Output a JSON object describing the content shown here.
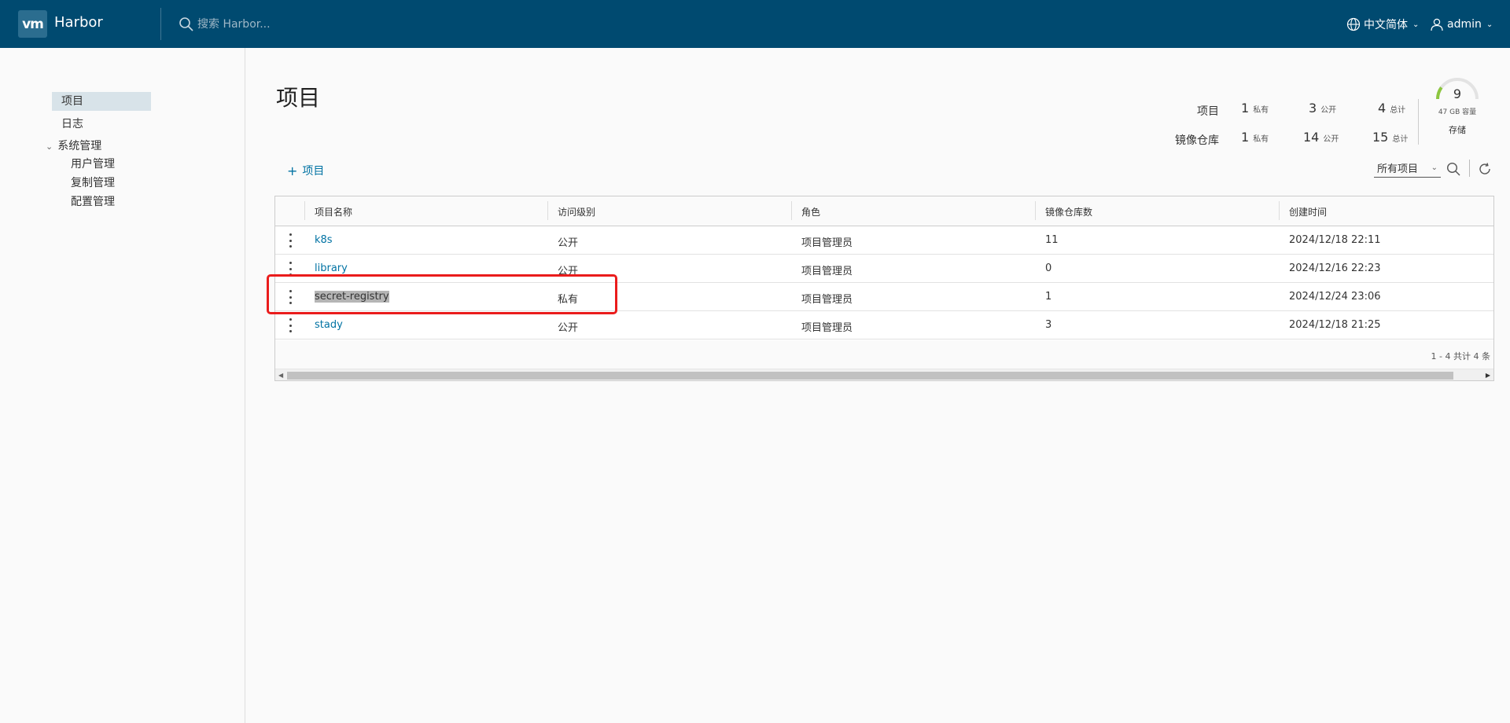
{
  "header": {
    "logo_text": "vm",
    "brand": "Harbor",
    "search_placeholder": "搜索 Harbor...",
    "language": "中文简体",
    "user": "admin"
  },
  "sidebar": {
    "items": [
      {
        "label": "项目"
      },
      {
        "label": "日志"
      },
      {
        "label": "系统管理"
      }
    ],
    "sub_items": [
      {
        "label": "用户管理"
      },
      {
        "label": "复制管理"
      },
      {
        "label": "配置管理"
      }
    ]
  },
  "main": {
    "title": "项目",
    "stats": {
      "projects_label": "项目",
      "repos_label": "镜像仓库",
      "private_label": "私有",
      "public_label": "公开",
      "total_label": "总计",
      "projects": {
        "private": "1",
        "public": "3",
        "total": "4"
      },
      "repos": {
        "private": "1",
        "public": "14",
        "total": "15"
      }
    },
    "storage": {
      "value": "9",
      "capacity": "47 GB 容量",
      "label": "存储",
      "used_fraction": 0.2
    },
    "add_project_label": "项目",
    "filter_label": "所有项目",
    "table": {
      "columns": [
        "项目名称",
        "访问级别",
        "角色",
        "镜像仓库数",
        "创建时间"
      ],
      "rows": [
        {
          "name": "k8s",
          "access": "公开",
          "role": "项目管理员",
          "repos": "11",
          "created": "2024/12/18 22:11"
        },
        {
          "name": "library",
          "access": "公开",
          "role": "项目管理员",
          "repos": "0",
          "created": "2024/12/16 22:23"
        },
        {
          "name": "secret-registry",
          "access": "私有",
          "role": "项目管理员",
          "repos": "1",
          "created": "2024/12/24 23:06"
        },
        {
          "name": "stady",
          "access": "公开",
          "role": "项目管理员",
          "repos": "3",
          "created": "2024/12/18 21:25"
        }
      ],
      "footer": "1 - 4 共计 4 条"
    }
  },
  "colors": {
    "header_bg": "#004a70",
    "link": "#0072a3",
    "highlight": "#ea1c1c",
    "gauge": "#8cc63f"
  }
}
